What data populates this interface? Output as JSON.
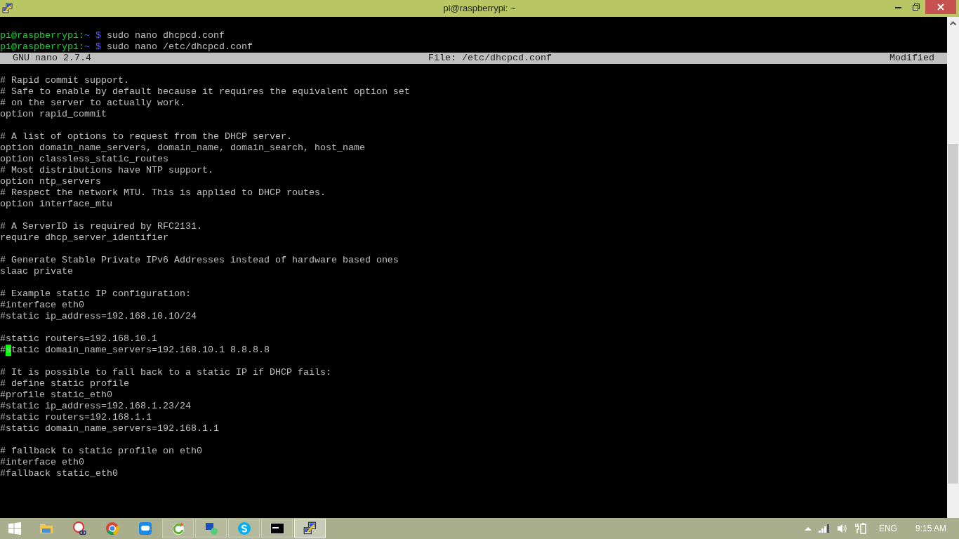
{
  "window": {
    "title": "pi@raspberrypi: ~"
  },
  "shell": [
    {
      "user_host": "pi@raspberrypi:",
      "path": "~ $",
      "command": "sudo nano dhcpcd.conf"
    },
    {
      "user_host": "pi@raspberrypi:",
      "path": "~ $",
      "command": "sudo nano /etc/dhcpcd.conf"
    }
  ],
  "nano_header": {
    "version": "GNU nano 2.7.4",
    "file": "File: /etc/dhcpcd.conf",
    "status": "Modified"
  },
  "editor_lines": [
    {
      "kind": "blank"
    },
    {
      "kind": "text",
      "text": "# Rapid commit support.",
      "cursor": false
    },
    {
      "kind": "text",
      "text": "# Safe to enable by default because it requires the equivalent option set",
      "cursor": false
    },
    {
      "kind": "text",
      "text": "# on the server to actually work.",
      "cursor": false
    },
    {
      "kind": "text",
      "text": "option rapid_commit",
      "cursor": false
    },
    {
      "kind": "blank"
    },
    {
      "kind": "text",
      "text": "# A list of options to request from the DHCP server.",
      "cursor": false
    },
    {
      "kind": "text",
      "text": "option domain_name_servers, domain_name, domain_search, host_name",
      "cursor": false
    },
    {
      "kind": "text",
      "text": "option classless_static_routes",
      "cursor": false
    },
    {
      "kind": "text",
      "text": "# Most distributions have NTP support.",
      "cursor": false
    },
    {
      "kind": "text",
      "text": "option ntp_servers",
      "cursor": false
    },
    {
      "kind": "text",
      "text": "# Respect the network MTU. This is applied to DHCP routes.",
      "cursor": false
    },
    {
      "kind": "text",
      "text": "option interface_mtu",
      "cursor": false
    },
    {
      "kind": "blank"
    },
    {
      "kind": "text",
      "text": "# A ServerID is required by RFC2131.",
      "cursor": false
    },
    {
      "kind": "text",
      "text": "require dhcp_server_identifier",
      "cursor": false
    },
    {
      "kind": "blank"
    },
    {
      "kind": "text",
      "text": "# Generate Stable Private IPv6 Addresses instead of hardware based ones",
      "cursor": false
    },
    {
      "kind": "text",
      "text": "slaac private",
      "cursor": false
    },
    {
      "kind": "blank"
    },
    {
      "kind": "text",
      "text": "# Example static IP configuration:",
      "cursor": false
    },
    {
      "kind": "text",
      "text": "#interface eth0",
      "cursor": false
    },
    {
      "kind": "text",
      "text": "#static ip_address=192.168.10.1O/24",
      "cursor": false
    },
    {
      "kind": "blank"
    },
    {
      "kind": "text",
      "text": "#static routers=192.168.10.1",
      "cursor": false
    },
    {
      "kind": "text",
      "text": "#static domain_name_servers=192.168.10.1 8.8.8.8",
      "cursor": true
    },
    {
      "kind": "blank"
    },
    {
      "kind": "text",
      "text": "# It is possible to fall back to a static IP if DHCP fails:",
      "cursor": false
    },
    {
      "kind": "text",
      "text": "# define static profile",
      "cursor": false
    },
    {
      "kind": "text",
      "text": "#profile static_eth0",
      "cursor": false
    },
    {
      "kind": "text",
      "text": "#static ip_address=192.168.1.23/24",
      "cursor": false
    },
    {
      "kind": "text",
      "text": "#static routers=192.168.1.1",
      "cursor": false
    },
    {
      "kind": "text",
      "text": "#static domain_name_servers=192.168.1.1",
      "cursor": false
    },
    {
      "kind": "blank"
    },
    {
      "kind": "text",
      "text": "# fallback to static profile on eth0",
      "cursor": false
    },
    {
      "kind": "text",
      "text": "#interface eth0",
      "cursor": false
    },
    {
      "kind": "text",
      "text": "#fallback static_eth0",
      "cursor": false
    }
  ],
  "taskbar": {
    "apps": [
      {
        "running": false,
        "selected": false
      },
      {
        "running": false,
        "selected": false
      },
      {
        "running": false,
        "selected": false
      },
      {
        "running": false,
        "selected": false
      },
      {
        "running": true,
        "selected": false
      },
      {
        "running": true,
        "selected": false
      },
      {
        "running": true,
        "selected": false
      },
      {
        "running": true,
        "selected": false
      },
      {
        "running": true,
        "selected": true
      }
    ],
    "language": "ENG",
    "time": "9:15 AM"
  }
}
